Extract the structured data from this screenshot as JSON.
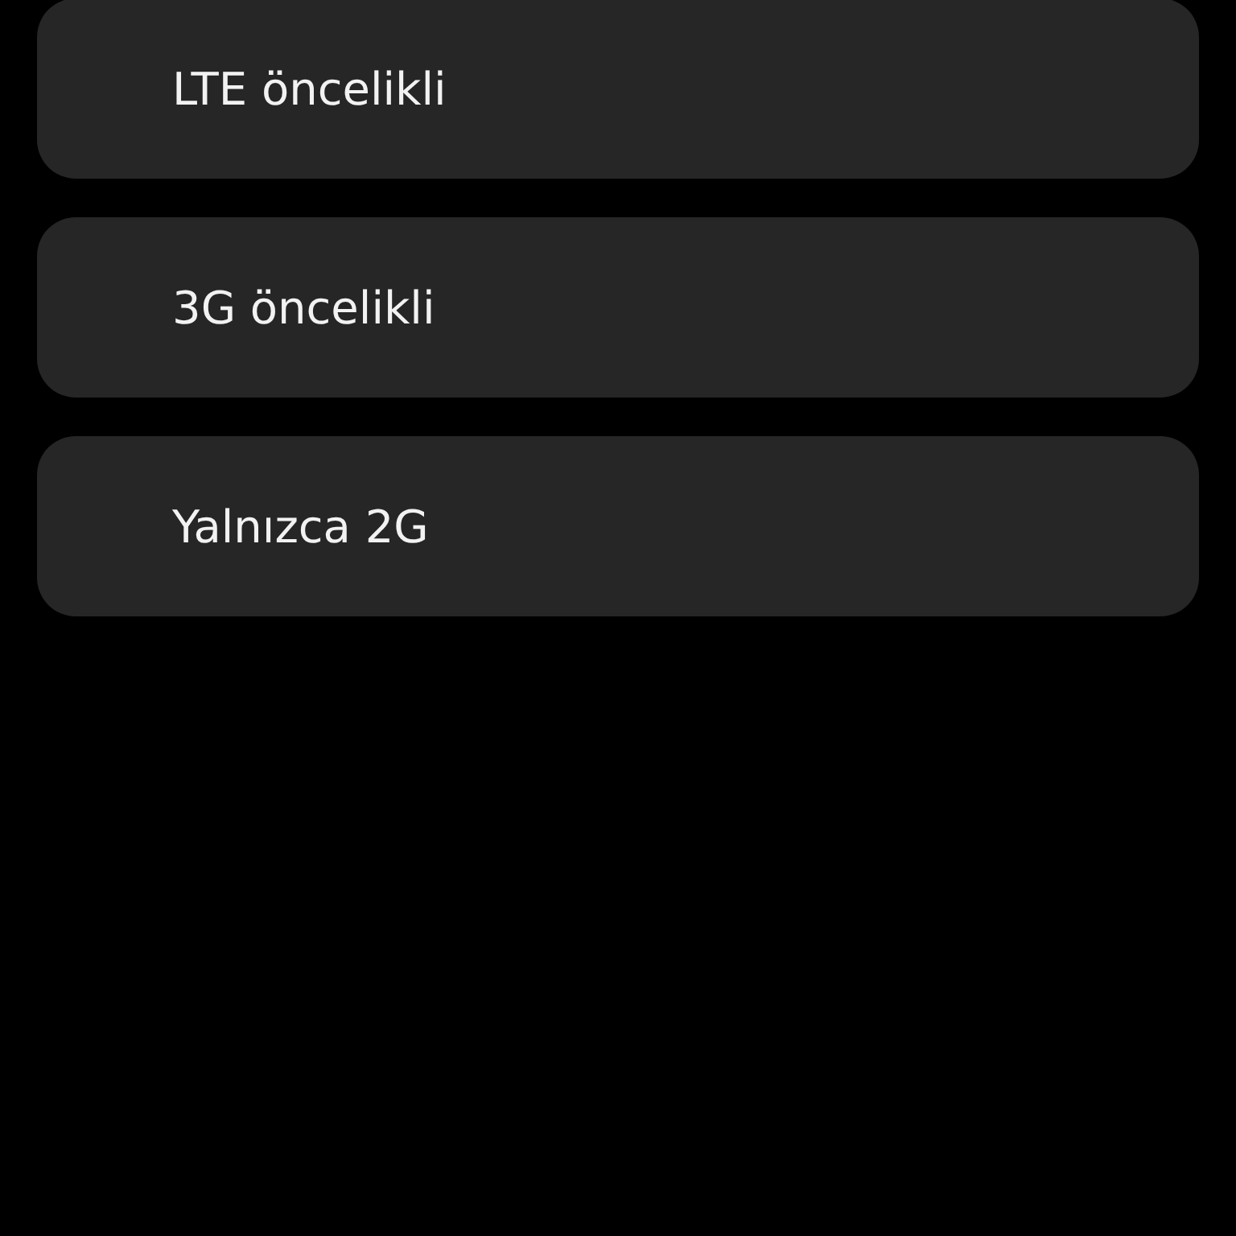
{
  "options": [
    {
      "label": "LTE öncelikli"
    },
    {
      "label": "3G öncelikli"
    },
    {
      "label": "Yalnızca 2G"
    }
  ]
}
